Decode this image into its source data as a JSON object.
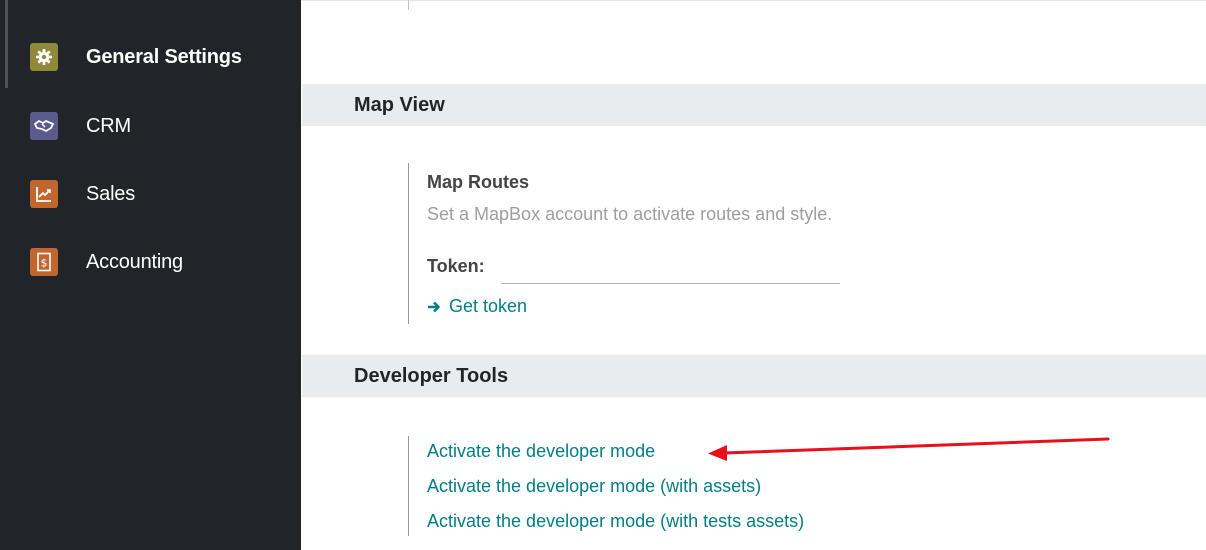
{
  "sidebar": {
    "items": [
      {
        "label": "General Settings",
        "icon": "gear-icon",
        "color": "#8f8a3b"
      },
      {
        "label": "CRM",
        "icon": "handshake-icon",
        "color": "#5a5a8c"
      },
      {
        "label": "Sales",
        "icon": "chart-line-icon",
        "color": "#c0672f"
      },
      {
        "label": "Accounting",
        "icon": "invoice-dollar-icon",
        "color": "#c0672f"
      }
    ]
  },
  "map_view": {
    "header": "Map View",
    "map_routes": {
      "title": "Map Routes",
      "description": "Set a MapBox account to activate routes and style.",
      "token_label": "Token:",
      "token_value": "",
      "get_token_label": "Get token"
    }
  },
  "developer_tools": {
    "header": "Developer Tools",
    "links": [
      "Activate the developer mode",
      "Activate the developer mode (with assets)",
      "Activate the developer mode (with tests assets)"
    ]
  },
  "colors": {
    "link": "#017e84",
    "annotation_arrow": "#e8101a",
    "sidebar_bg": "#212529"
  }
}
